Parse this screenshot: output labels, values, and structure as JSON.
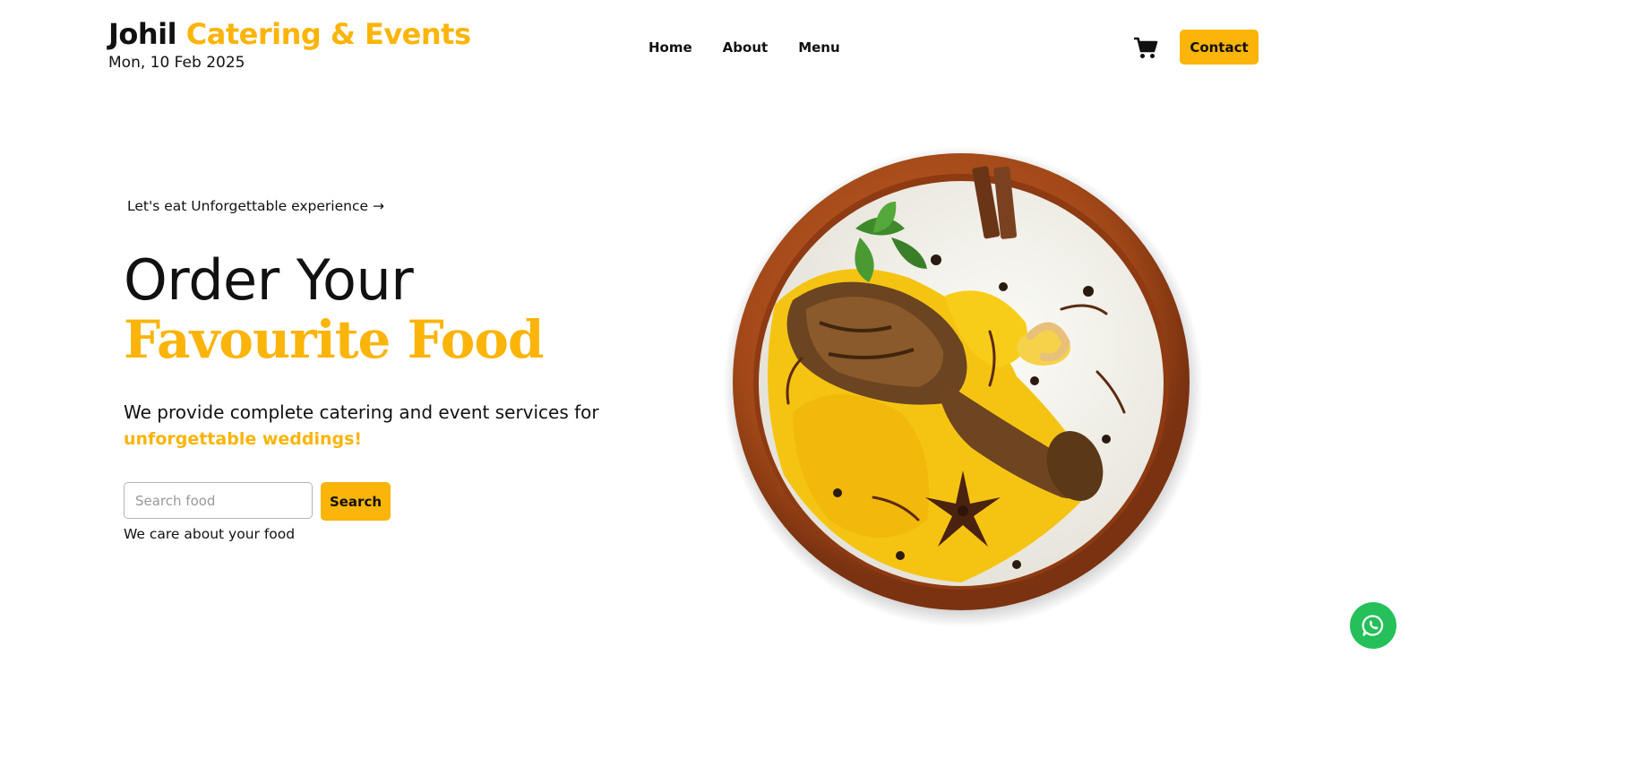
{
  "header": {
    "brand_part1": "Johil",
    "brand_part2": "Catering & Events",
    "date": "Mon, 10 Feb 2025",
    "nav": [
      {
        "label": "Home"
      },
      {
        "label": "About"
      },
      {
        "label": "Menu"
      }
    ],
    "cart_icon": "shopping-cart-icon",
    "contact_label": "Contact"
  },
  "hero": {
    "tagline": "Let's eat  Unforgettable experience →",
    "heading_line1": "Order Your",
    "heading_line2": "Favourite Food",
    "description": "We provide complete catering and event services for",
    "description_highlight": "unforgettable weddings!",
    "search_placeholder": "Search food",
    "search_value": "",
    "search_label": "Search",
    "footnote": "We care about your food",
    "image_icon": "biryani-bowl-image"
  },
  "floating": {
    "whatsapp_icon": "whatsapp-icon"
  },
  "colors": {
    "accent": "#fbb40a",
    "text": "#111111",
    "whatsapp": "#25c05a"
  }
}
